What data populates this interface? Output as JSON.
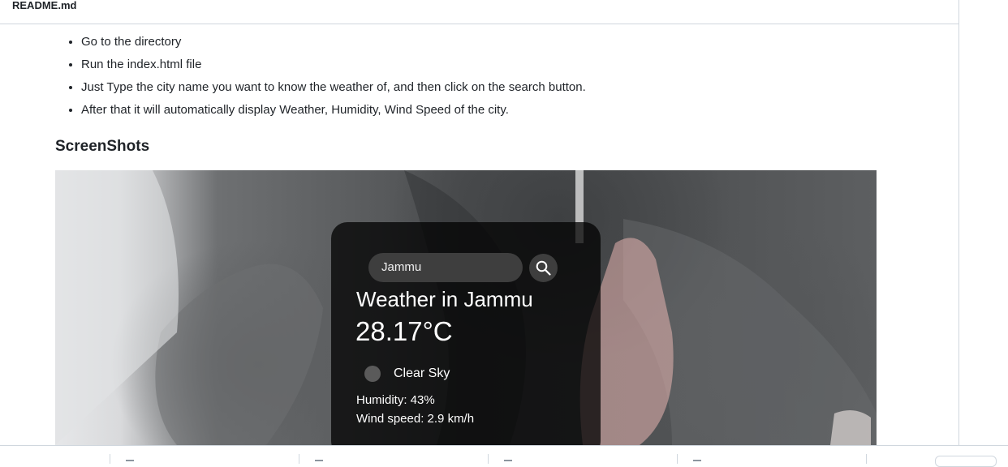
{
  "file": {
    "name": "README.md"
  },
  "instructions": [
    "Go to the directory",
    "Run the index.html file",
    "Just Type the city name you want to know the weather of, and then click on the search button.",
    "After that it will automatically display Weather, Humidity, Wind Speed of the city."
  ],
  "section": {
    "heading": "ScreenShots"
  },
  "screenshot": {
    "search_value": "Jammu",
    "title": "Weather in Jammu",
    "temperature": "28.17°C",
    "description": "Clear Sky",
    "humidity": "Humidity: 43%",
    "wind": "Wind speed: 2.9 km/h",
    "search_icon": "search-icon",
    "weather_icon": "weather-icon"
  },
  "colors": {
    "text": "#1f2328",
    "border": "#d0d7de",
    "card_background": "#000000",
    "card_text": "#ffffff"
  }
}
